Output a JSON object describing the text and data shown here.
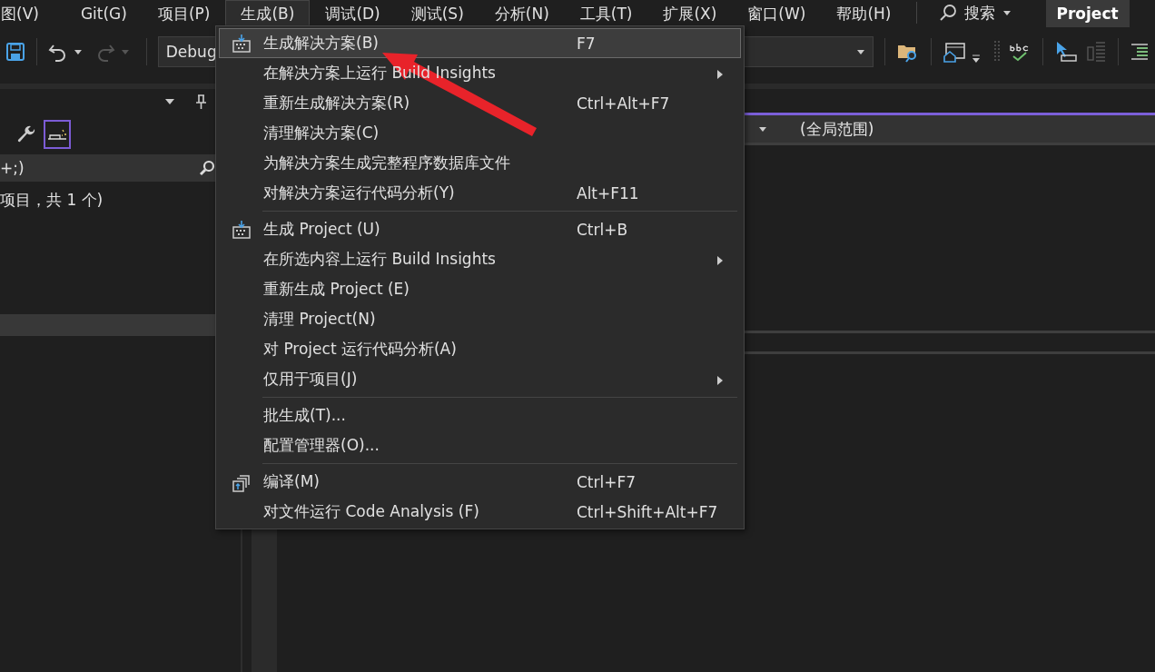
{
  "menu_bar": {
    "items": [
      {
        "label": "图(V)",
        "selected": false
      },
      {
        "label": "Git(G)",
        "selected": false
      },
      {
        "label": "项目(P)",
        "selected": false
      },
      {
        "label": "生成(B)",
        "selected": true
      },
      {
        "label": "调试(D)",
        "selected": false
      },
      {
        "label": "测试(S)",
        "selected": false
      },
      {
        "label": "分析(N)",
        "selected": false
      },
      {
        "label": "工具(T)",
        "selected": false
      },
      {
        "label": "扩展(X)",
        "selected": false
      },
      {
        "label": "窗口(W)",
        "selected": false
      },
      {
        "label": "帮助(H)",
        "selected": false
      }
    ],
    "search": "搜索",
    "project_badge": "Project"
  },
  "toolbar": {
    "configuration": "Debug"
  },
  "left_panel": {
    "search_text": "+;)",
    "tree_text": "项目，共 1 个)"
  },
  "editor": {
    "scope": "(全局范围)"
  },
  "build_menu": {
    "items": [
      {
        "kind": "build_item",
        "label": "生成解决方案(B)",
        "shortcut": "F7",
        "submenu": false,
        "selected": true
      },
      {
        "kind": "item",
        "label": "在解决方案上运行 Build Insights",
        "submenu": true,
        "selected": false
      },
      {
        "kind": "item",
        "label": "重新生成解决方案(R)",
        "shortcut": "Ctrl+Alt+F7",
        "submenu": false,
        "selected": false
      },
      {
        "kind": "item",
        "label": "清理解决方案(C)",
        "submenu": false,
        "selected": false
      },
      {
        "kind": "item",
        "label": "为解决方案生成完整程序数据库文件",
        "submenu": false,
        "selected": false
      },
      {
        "kind": "item",
        "label": "对解决方案运行代码分析(Y)",
        "shortcut": "Alt+F11",
        "submenu": false,
        "selected": false
      },
      {
        "kind": "separator"
      },
      {
        "kind": "build_item",
        "label": "生成 Project (U)",
        "shortcut": "Ctrl+B",
        "submenu": false,
        "selected": false
      },
      {
        "kind": "item",
        "label": "在所选内容上运行 Build Insights",
        "submenu": true,
        "selected": false
      },
      {
        "kind": "item",
        "label": "重新生成 Project (E)",
        "submenu": false,
        "selected": false
      },
      {
        "kind": "item",
        "label": "清理 Project(N)",
        "submenu": false,
        "selected": false
      },
      {
        "kind": "item",
        "label": "对 Project 运行代码分析(A)",
        "submenu": false,
        "selected": false
      },
      {
        "kind": "item",
        "label": "仅用于项目(J)",
        "submenu": true,
        "selected": false
      },
      {
        "kind": "separator"
      },
      {
        "kind": "item",
        "label": "批生成(T)...",
        "submenu": false,
        "selected": false
      },
      {
        "kind": "item",
        "label": "配置管理器(O)...",
        "submenu": false,
        "selected": false
      },
      {
        "kind": "separator"
      },
      {
        "kind": "compile_item",
        "label": "编译(M)",
        "shortcut": "Ctrl+F7",
        "submenu": false,
        "selected": false
      },
      {
        "kind": "item",
        "label": "对文件运行 Code Analysis (F)",
        "shortcut": "Ctrl+Shift+Alt+F7",
        "submenu": false,
        "selected": false
      }
    ]
  }
}
